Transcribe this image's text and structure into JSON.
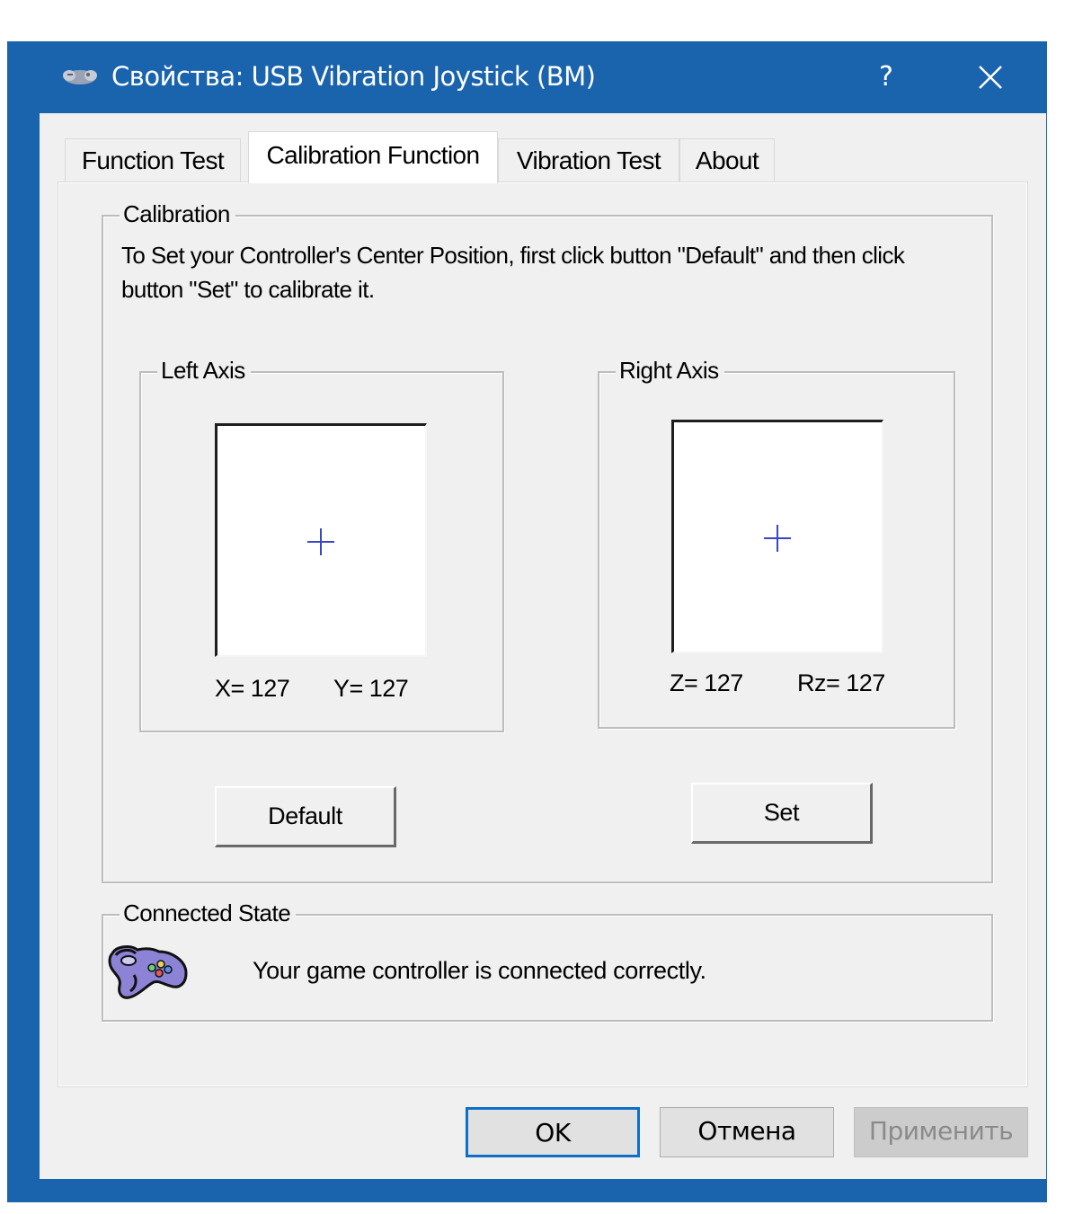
{
  "window": {
    "title": "Свойства: USB Vibration Joystick (BM)",
    "help_label": "?",
    "title_bar_color": "#1a63ad"
  },
  "tabs": [
    {
      "label": "Function Test",
      "active": false
    },
    {
      "label": "Calibration Function",
      "active": true
    },
    {
      "label": "Vibration Test",
      "active": false
    },
    {
      "label": "About",
      "active": false
    }
  ],
  "calibration": {
    "group_label": "Calibration",
    "description": "To Set your Controller's  Center Position, first click button \"Default\" and then click button \"Set\" to calibrate it.",
    "left_axis": {
      "label": "Left Axis",
      "x_text": "X= 127",
      "y_text": "Y= 127"
    },
    "right_axis": {
      "label": "Right Axis",
      "z_text": "Z= 127",
      "rz_text": "Rz= 127"
    },
    "default_button": "Default",
    "set_button": "Set"
  },
  "connected_state": {
    "group_label": "Connected State",
    "message": "Your game controller is connected correctly.",
    "icon": "gamepad-icon"
  },
  "dialog_buttons": {
    "ok": "OK",
    "cancel": "Отмена",
    "apply": "Применить"
  },
  "colors": {
    "accent": "#0f6fc6",
    "crosshair": "#3a46c2"
  }
}
